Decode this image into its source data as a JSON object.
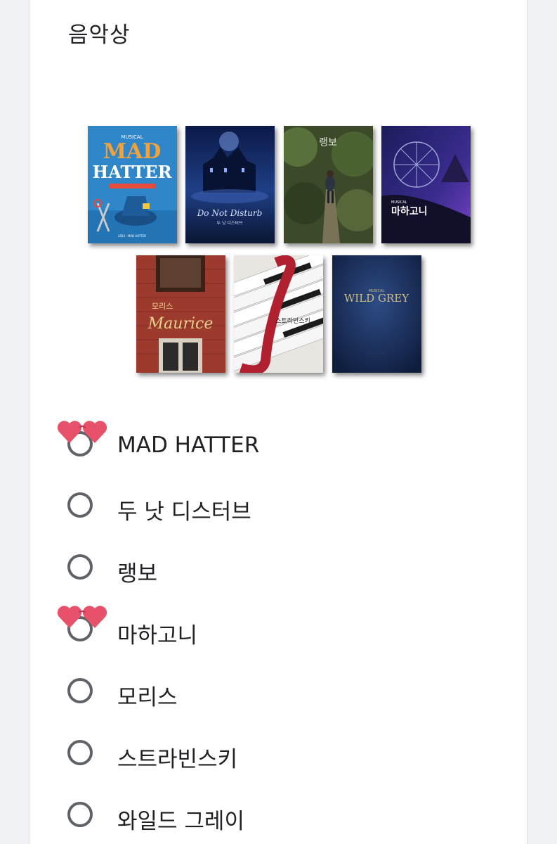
{
  "question": {
    "title": "음악상"
  },
  "posters": [
    {
      "name": "poster-mad-hatter",
      "caption_top": "MUSICAL",
      "caption_main": "MAD",
      "caption_sub": "HATTER"
    },
    {
      "name": "poster-do-not-disturb",
      "caption_main": "Do Not Disturb",
      "caption_sub": "두 낫 디스터브"
    },
    {
      "name": "poster-rimbaud",
      "caption_main": "랭보"
    },
    {
      "name": "poster-mahagonny",
      "caption_top": "MUSICAL",
      "caption_main": "마하고니"
    },
    {
      "name": "poster-maurice",
      "caption_top": "모리스",
      "caption_main": "Maurice"
    },
    {
      "name": "poster-stravinsky",
      "caption_main": "스트라빈스키"
    },
    {
      "name": "poster-wild-grey",
      "caption_top": "MUSICAL",
      "caption_main": "WILD GREY"
    }
  ],
  "options": [
    {
      "label": "MAD HATTER",
      "hearts": true
    },
    {
      "label": "두 낫 디스터브",
      "hearts": false
    },
    {
      "label": "랭보",
      "hearts": false
    },
    {
      "label": "마하고니",
      "hearts": true
    },
    {
      "label": "모리스",
      "hearts": false
    },
    {
      "label": "스트라빈스키",
      "hearts": false
    },
    {
      "label": "와일드 그레이",
      "hearts": false
    }
  ],
  "colors": {
    "page_bg": "#f1f2f6",
    "radio_border": "#5f6368",
    "heart": "#e8516a",
    "text": "#202124"
  }
}
